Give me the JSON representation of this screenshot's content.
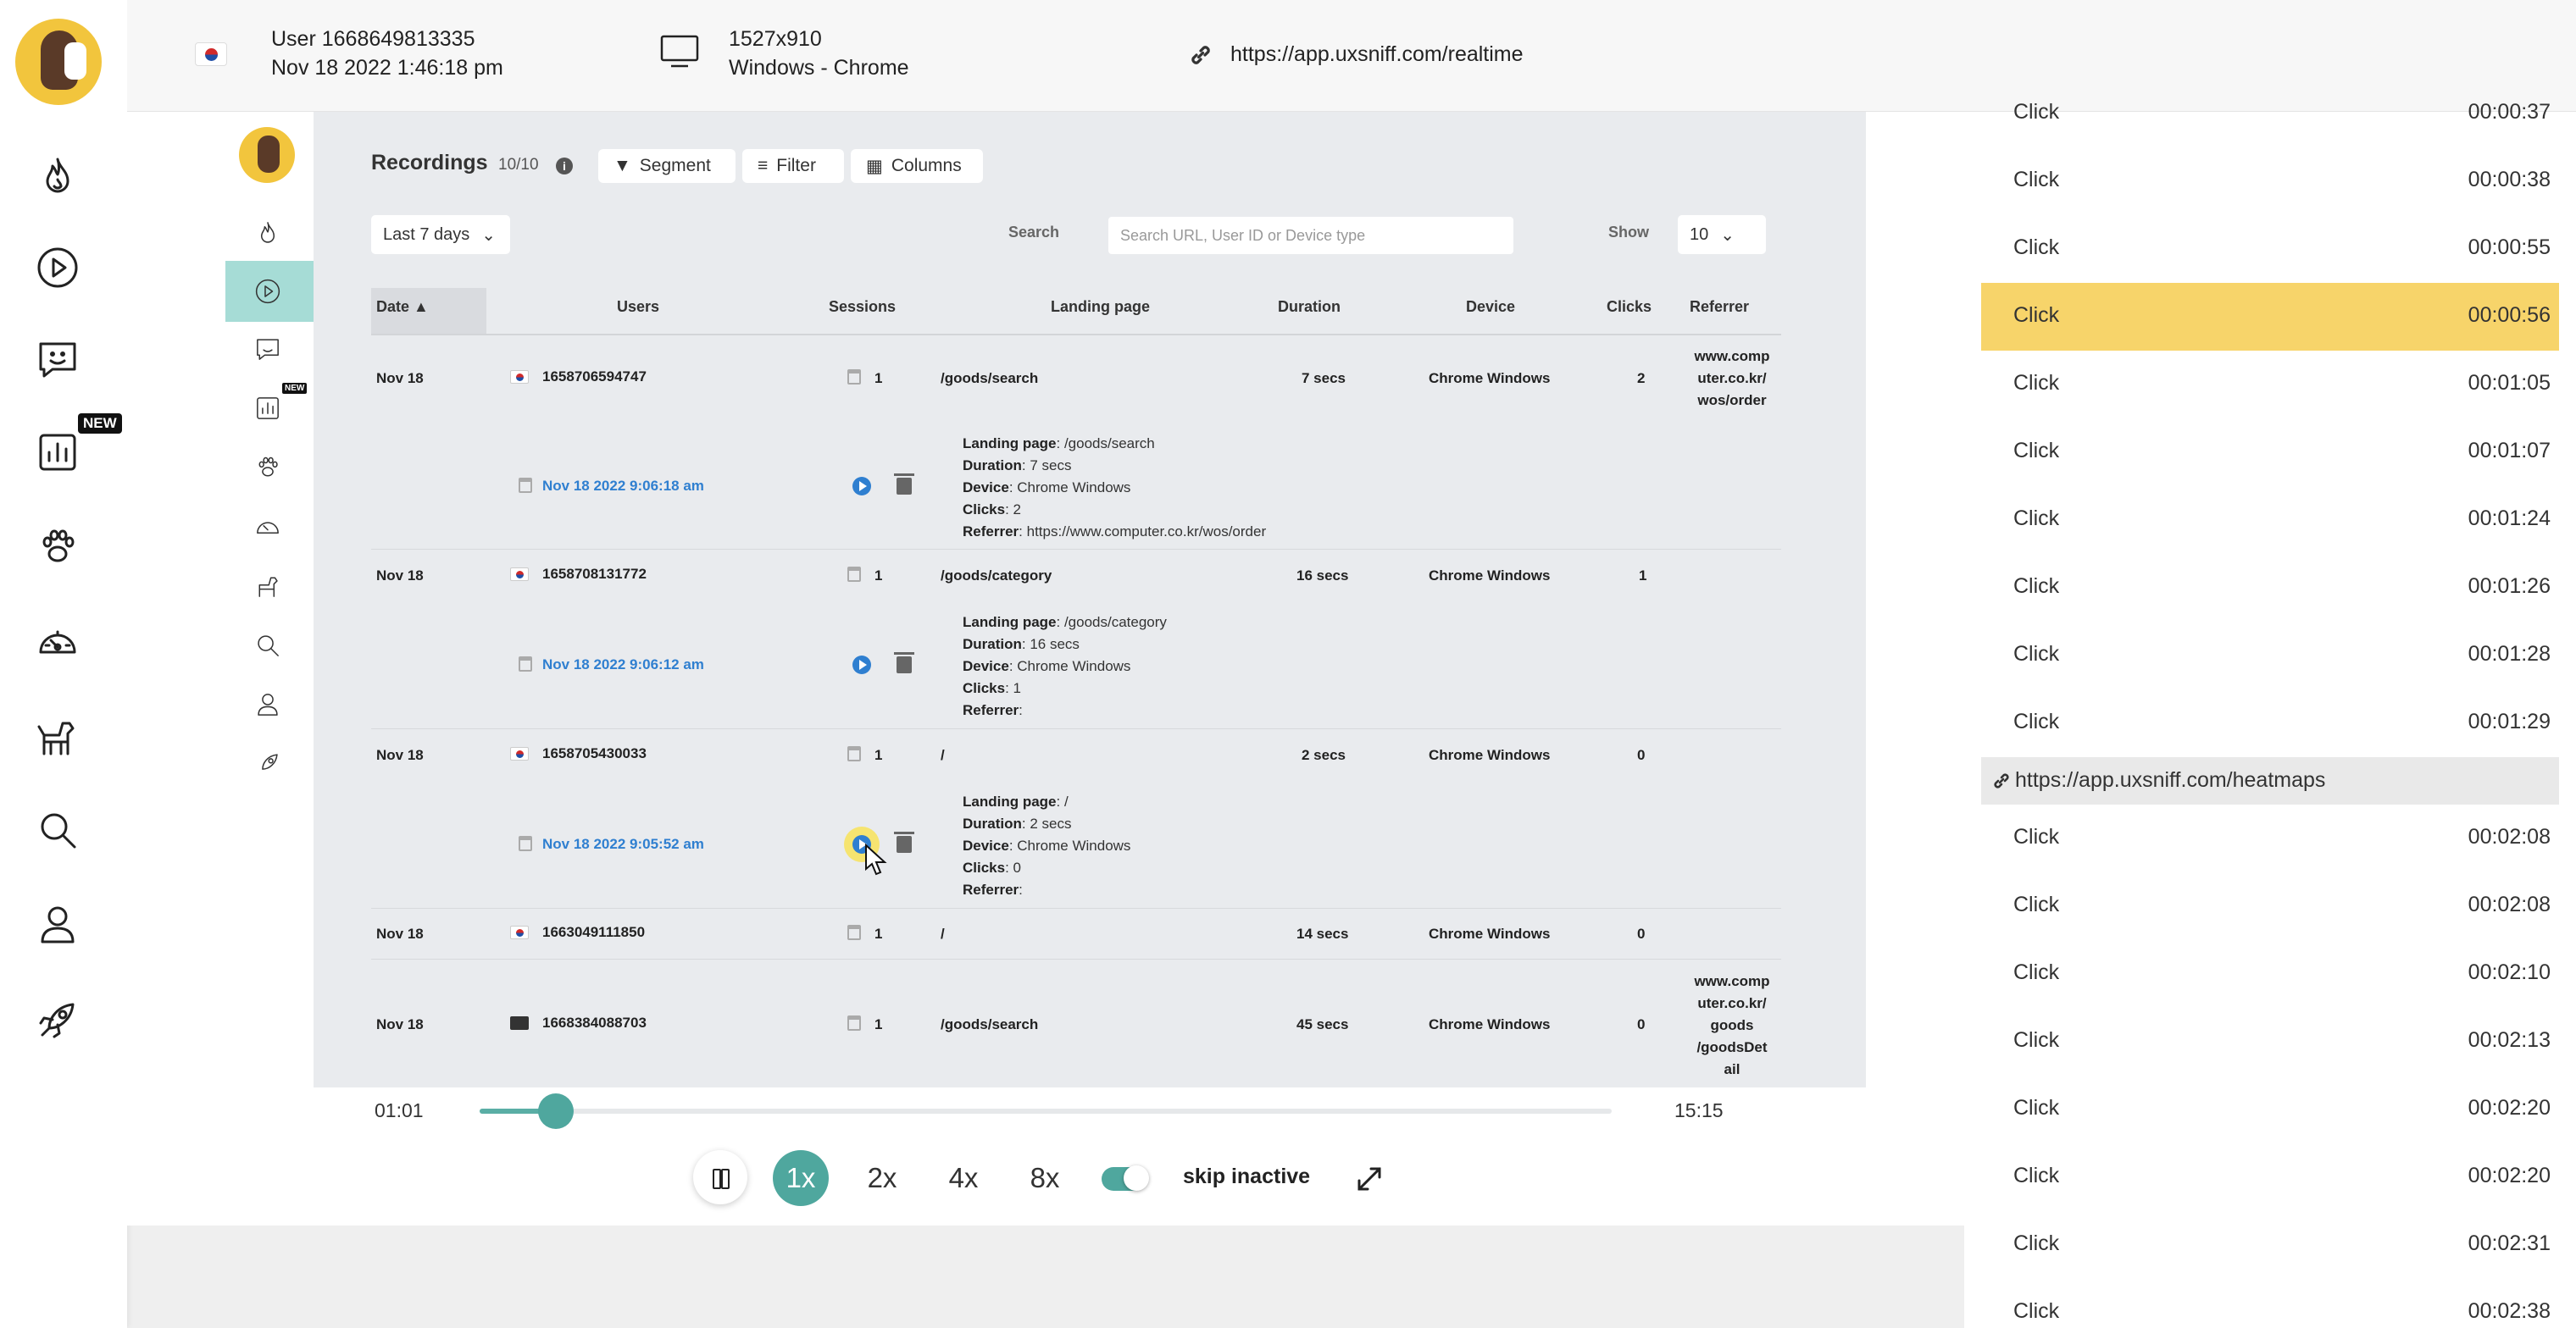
{
  "top": {
    "user": "User 1668649813335",
    "datetime": "Nov 18 2022 1:46:18 pm",
    "resolution": "1527x910",
    "platform": "Windows - Chrome",
    "url": "https://app.uxsniff.com/realtime"
  },
  "sidebar": {
    "items": [
      {
        "icon": "fire-icon"
      },
      {
        "icon": "play-circle-icon"
      },
      {
        "icon": "feedback-icon"
      },
      {
        "icon": "bar-chart-icon",
        "badge": "NEW"
      },
      {
        "icon": "paw-icon"
      },
      {
        "icon": "gauge-icon"
      },
      {
        "icon": "dog-icon"
      },
      {
        "icon": "search-icon"
      },
      {
        "icon": "user-icon"
      },
      {
        "icon": "rocket-icon"
      }
    ],
    "badge": "NEW"
  },
  "recordings": {
    "title": "Recordings",
    "count": "10/10",
    "segment_label": "Segment",
    "filter_label": "Filter",
    "columns_label": "Columns",
    "range_value": "Last 7 days",
    "search_label": "Search",
    "search_placeholder": "Search URL, User ID or Device type",
    "show_label": "Show",
    "show_value": "10",
    "headers": {
      "date": "Date",
      "users": "Users",
      "sessions": "Sessions",
      "landing": "Landing page",
      "duration": "Duration",
      "device": "Device",
      "clicks": "Clicks",
      "referrer": "Referrer"
    },
    "rows": [
      {
        "date": "Nov 18",
        "user": "1658706594747",
        "sessions": "1",
        "landing": "/goods/search",
        "duration": "7 secs",
        "device": "Chrome Windows",
        "clicks": "2",
        "referrer_lines": [
          "www.comp",
          "uter.co.kr/",
          "wos/order"
        ],
        "session_time": "Nov 18 2022 9:06:18 am",
        "detail": {
          "landing": "/goods/search",
          "duration": "7 secs",
          "device": "Chrome Windows",
          "clicks": "2",
          "referrer": "https://www.computer.co.kr/wos/order"
        }
      },
      {
        "date": "Nov 18",
        "user": "1658708131772",
        "sessions": "1",
        "landing": "/goods/category",
        "duration": "16 secs",
        "device": "Chrome Windows",
        "clicks": "1",
        "referrer_lines": [],
        "session_time": "Nov 18 2022 9:06:12 am",
        "detail": {
          "landing": "/goods/category",
          "duration": "16 secs",
          "device": "Chrome Windows",
          "clicks": "1",
          "referrer": ""
        }
      },
      {
        "date": "Nov 18",
        "user": "1658705430033",
        "sessions": "1",
        "landing": "/",
        "duration": "2 secs",
        "device": "Chrome Windows",
        "clicks": "0",
        "referrer_lines": [],
        "session_time": "Nov 18 2022 9:05:52 am",
        "detail": {
          "landing": "/",
          "duration": "2 secs",
          "device": "Chrome Windows",
          "clicks": "0",
          "referrer": ""
        }
      },
      {
        "date": "Nov 18",
        "user": "1663049111850",
        "sessions": "1",
        "landing": "/",
        "duration": "14 secs",
        "device": "Chrome Windows",
        "clicks": "0",
        "referrer_lines": []
      },
      {
        "date": "Nov 18",
        "user": "1668384088703",
        "sessions": "1",
        "landing": "/goods/search",
        "duration": "45 secs",
        "device": "Chrome Windows",
        "clicks": "0",
        "referrer_lines": [
          "www.comp",
          "uter.co.kr/",
          "goods",
          "/goodsDet",
          "ail"
        ]
      }
    ],
    "detail_labels": {
      "landing": "Landing page",
      "duration": "Duration",
      "device": "Device",
      "clicks": "Clicks",
      "referrer": "Referrer"
    }
  },
  "player": {
    "current": "01:01",
    "total": "15:15",
    "progress": 0.067,
    "speeds": [
      "1x",
      "2x",
      "4x",
      "8x"
    ],
    "active_speed": "1x",
    "skip_label": "skip inactive",
    "skip_on": true
  },
  "events": {
    "items": [
      {
        "label": "Click",
        "time": "00:00:37"
      },
      {
        "label": "Click",
        "time": "00:00:38"
      },
      {
        "label": "Click",
        "time": "00:00:55"
      },
      {
        "label": "Click",
        "time": "00:00:56",
        "active": true
      },
      {
        "label": "Click",
        "time": "00:01:05"
      },
      {
        "label": "Click",
        "time": "00:01:07"
      },
      {
        "label": "Click",
        "time": "00:01:24"
      },
      {
        "label": "Click",
        "time": "00:01:26"
      },
      {
        "label": "Click",
        "time": "00:01:28"
      },
      {
        "label": "Click",
        "time": "00:01:29"
      }
    ],
    "page_url": "https://app.uxsniff.com/heatmaps",
    "items2": [
      {
        "label": "Click",
        "time": "00:02:08"
      },
      {
        "label": "Click",
        "time": "00:02:08"
      },
      {
        "label": "Click",
        "time": "00:02:10"
      },
      {
        "label": "Click",
        "time": "00:02:13"
      },
      {
        "label": "Click",
        "time": "00:02:20"
      },
      {
        "label": "Click",
        "time": "00:02:20"
      },
      {
        "label": "Click",
        "time": "00:02:31"
      },
      {
        "label": "Click",
        "time": "00:02:38"
      }
    ]
  },
  "colors": {
    "accent": "#4fa79e",
    "highlight": "#f7d46a",
    "link": "#2f7fd0",
    "brand": "#f2c53d"
  }
}
